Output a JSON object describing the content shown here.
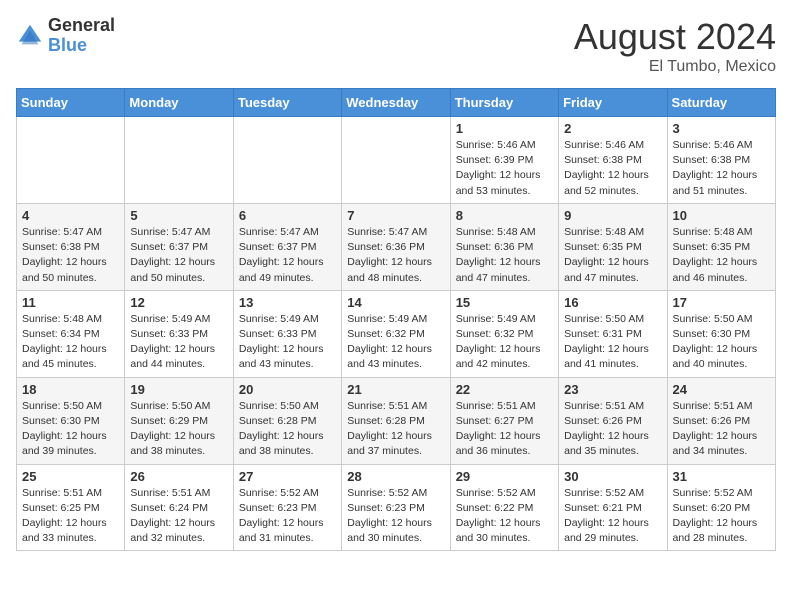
{
  "logo": {
    "line1": "General",
    "line2": "Blue"
  },
  "title": "August 2024",
  "subtitle": "El Tumbo, Mexico",
  "weekdays": [
    "Sunday",
    "Monday",
    "Tuesday",
    "Wednesday",
    "Thursday",
    "Friday",
    "Saturday"
  ],
  "weeks": [
    [
      {
        "day": "",
        "info": ""
      },
      {
        "day": "",
        "info": ""
      },
      {
        "day": "",
        "info": ""
      },
      {
        "day": "",
        "info": ""
      },
      {
        "day": "1",
        "info": "Sunrise: 5:46 AM\nSunset: 6:39 PM\nDaylight: 12 hours\nand 53 minutes."
      },
      {
        "day": "2",
        "info": "Sunrise: 5:46 AM\nSunset: 6:38 PM\nDaylight: 12 hours\nand 52 minutes."
      },
      {
        "day": "3",
        "info": "Sunrise: 5:46 AM\nSunset: 6:38 PM\nDaylight: 12 hours\nand 51 minutes."
      }
    ],
    [
      {
        "day": "4",
        "info": "Sunrise: 5:47 AM\nSunset: 6:38 PM\nDaylight: 12 hours\nand 50 minutes."
      },
      {
        "day": "5",
        "info": "Sunrise: 5:47 AM\nSunset: 6:37 PM\nDaylight: 12 hours\nand 50 minutes."
      },
      {
        "day": "6",
        "info": "Sunrise: 5:47 AM\nSunset: 6:37 PM\nDaylight: 12 hours\nand 49 minutes."
      },
      {
        "day": "7",
        "info": "Sunrise: 5:47 AM\nSunset: 6:36 PM\nDaylight: 12 hours\nand 48 minutes."
      },
      {
        "day": "8",
        "info": "Sunrise: 5:48 AM\nSunset: 6:36 PM\nDaylight: 12 hours\nand 47 minutes."
      },
      {
        "day": "9",
        "info": "Sunrise: 5:48 AM\nSunset: 6:35 PM\nDaylight: 12 hours\nand 47 minutes."
      },
      {
        "day": "10",
        "info": "Sunrise: 5:48 AM\nSunset: 6:35 PM\nDaylight: 12 hours\nand 46 minutes."
      }
    ],
    [
      {
        "day": "11",
        "info": "Sunrise: 5:48 AM\nSunset: 6:34 PM\nDaylight: 12 hours\nand 45 minutes."
      },
      {
        "day": "12",
        "info": "Sunrise: 5:49 AM\nSunset: 6:33 PM\nDaylight: 12 hours\nand 44 minutes."
      },
      {
        "day": "13",
        "info": "Sunrise: 5:49 AM\nSunset: 6:33 PM\nDaylight: 12 hours\nand 43 minutes."
      },
      {
        "day": "14",
        "info": "Sunrise: 5:49 AM\nSunset: 6:32 PM\nDaylight: 12 hours\nand 43 minutes."
      },
      {
        "day": "15",
        "info": "Sunrise: 5:49 AM\nSunset: 6:32 PM\nDaylight: 12 hours\nand 42 minutes."
      },
      {
        "day": "16",
        "info": "Sunrise: 5:50 AM\nSunset: 6:31 PM\nDaylight: 12 hours\nand 41 minutes."
      },
      {
        "day": "17",
        "info": "Sunrise: 5:50 AM\nSunset: 6:30 PM\nDaylight: 12 hours\nand 40 minutes."
      }
    ],
    [
      {
        "day": "18",
        "info": "Sunrise: 5:50 AM\nSunset: 6:30 PM\nDaylight: 12 hours\nand 39 minutes."
      },
      {
        "day": "19",
        "info": "Sunrise: 5:50 AM\nSunset: 6:29 PM\nDaylight: 12 hours\nand 38 minutes."
      },
      {
        "day": "20",
        "info": "Sunrise: 5:50 AM\nSunset: 6:28 PM\nDaylight: 12 hours\nand 38 minutes."
      },
      {
        "day": "21",
        "info": "Sunrise: 5:51 AM\nSunset: 6:28 PM\nDaylight: 12 hours\nand 37 minutes."
      },
      {
        "day": "22",
        "info": "Sunrise: 5:51 AM\nSunset: 6:27 PM\nDaylight: 12 hours\nand 36 minutes."
      },
      {
        "day": "23",
        "info": "Sunrise: 5:51 AM\nSunset: 6:26 PM\nDaylight: 12 hours\nand 35 minutes."
      },
      {
        "day": "24",
        "info": "Sunrise: 5:51 AM\nSunset: 6:26 PM\nDaylight: 12 hours\nand 34 minutes."
      }
    ],
    [
      {
        "day": "25",
        "info": "Sunrise: 5:51 AM\nSunset: 6:25 PM\nDaylight: 12 hours\nand 33 minutes."
      },
      {
        "day": "26",
        "info": "Sunrise: 5:51 AM\nSunset: 6:24 PM\nDaylight: 12 hours\nand 32 minutes."
      },
      {
        "day": "27",
        "info": "Sunrise: 5:52 AM\nSunset: 6:23 PM\nDaylight: 12 hours\nand 31 minutes."
      },
      {
        "day": "28",
        "info": "Sunrise: 5:52 AM\nSunset: 6:23 PM\nDaylight: 12 hours\nand 30 minutes."
      },
      {
        "day": "29",
        "info": "Sunrise: 5:52 AM\nSunset: 6:22 PM\nDaylight: 12 hours\nand 30 minutes."
      },
      {
        "day": "30",
        "info": "Sunrise: 5:52 AM\nSunset: 6:21 PM\nDaylight: 12 hours\nand 29 minutes."
      },
      {
        "day": "31",
        "info": "Sunrise: 5:52 AM\nSunset: 6:20 PM\nDaylight: 12 hours\nand 28 minutes."
      }
    ]
  ]
}
